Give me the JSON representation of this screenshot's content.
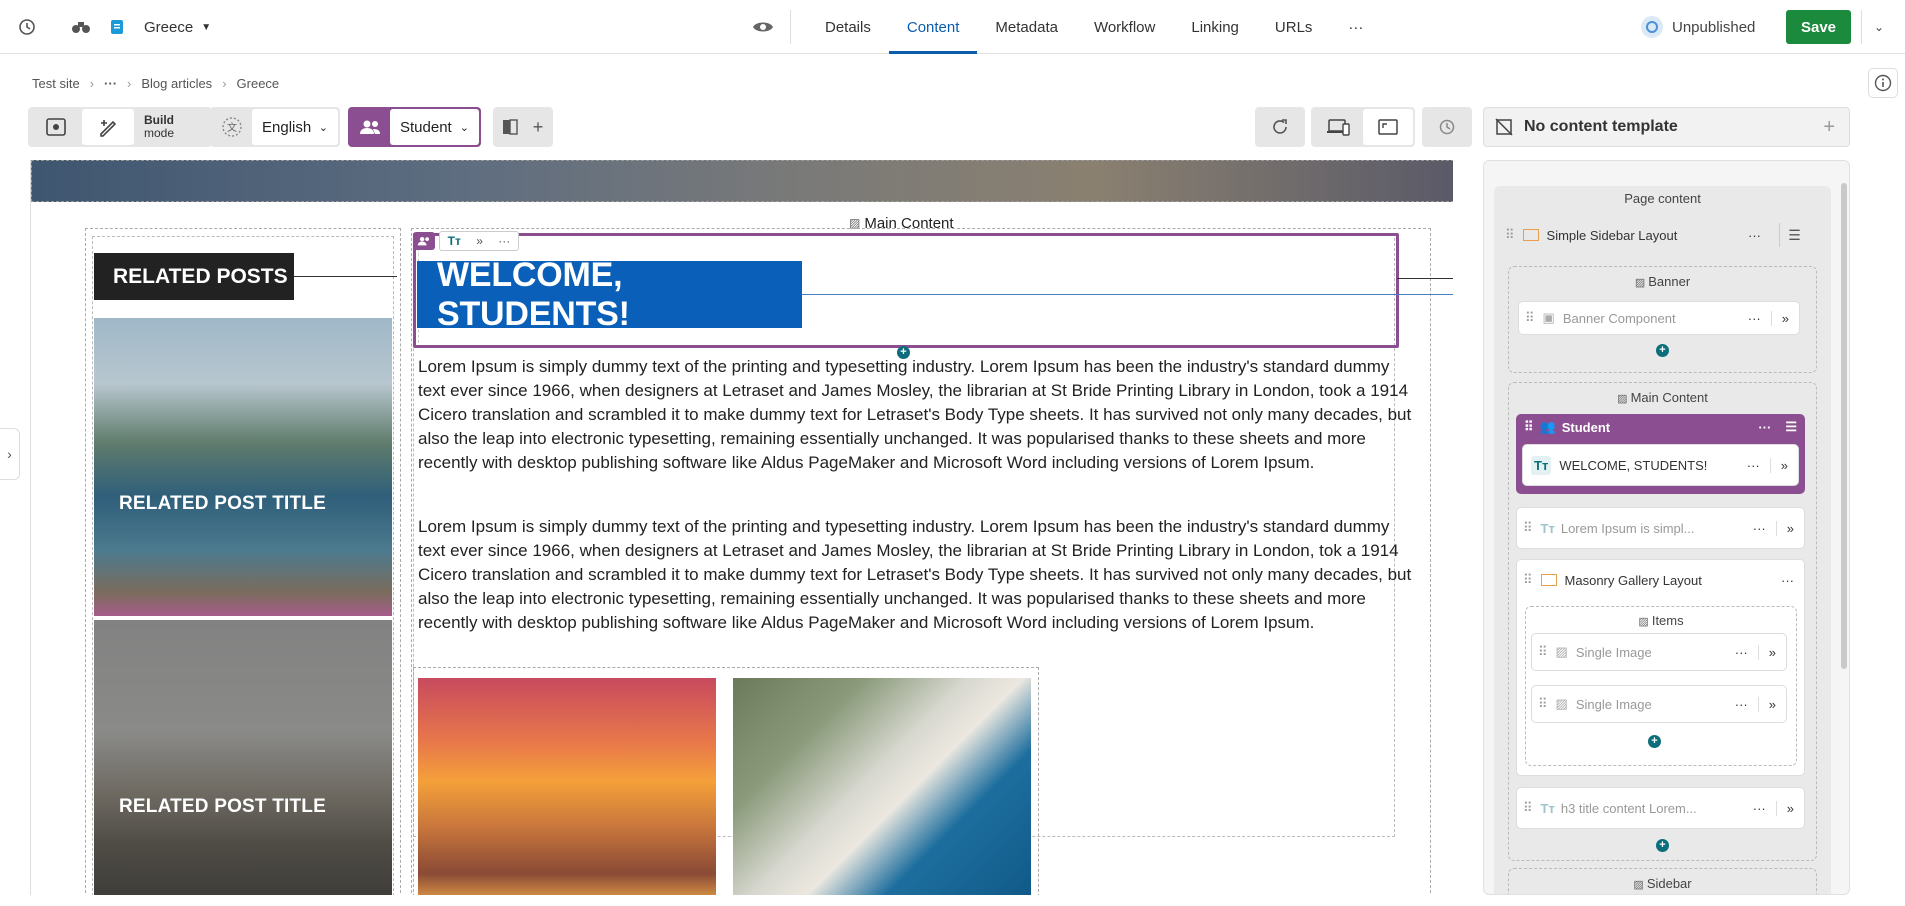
{
  "topbar": {
    "page_name": "Greece",
    "tabs": [
      "Details",
      "Content",
      "Metadata",
      "Workflow",
      "Linking",
      "URLs"
    ],
    "active_tab": "Content",
    "status": "Unpublished",
    "save_label": "Save"
  },
  "breadcrumb": {
    "items": [
      "Test site",
      "···",
      "Blog articles",
      "Greece"
    ]
  },
  "toolbar": {
    "build_mode_label_1": "Build",
    "build_mode_label_2": "mode",
    "language": "English",
    "audience": "Student",
    "template": "No content template"
  },
  "canvas": {
    "main_content_label": "Main Content",
    "related_posts_title": "RELATED POSTS",
    "related_post_title_1": "RELATED POST TITLE",
    "related_post_title_2": "RELATED POST TITLE",
    "welcome_heading": "WELCOME, STUDENTS!",
    "paragraph_1": "Lorem Ipsum is simply dummy text of the printing and typesetting industry. Lorem Ipsum has been the industry's standard dummy text ever since 1966, when designers at Letraset and James Mosley, the librarian at St Bride Printing Library in London, took a 1914 Cicero translation and scrambled it to make dummy text for Letraset's Body Type sheets. It has survived not only many decades, but also the leap into electronic typesetting, remaining essentially unchanged. It was popularised thanks to these sheets and more recently with desktop publishing software like Aldus PageMaker and Microsoft Word including versions of Lorem Ipsum.",
    "paragraph_2": " Lorem Ipsum is simply dummy text of the printing and typesetting industry. Lorem Ipsum has been the industry's standard dummy text ever since 1966, when designers at Letraset and James Mosley, the librarian at St Bride Printing Library in London, tok a 1914 Cicero translation and scrambled it to make dummy text for Letraset's Body Type sheets. It has survived not only many decades, but also the leap into electronic typesetting, remaining essentially unchanged. It was popularised thanks to these sheets and more recently with desktop publishing software like Aldus PageMaker and Microsoft Word including versions of Lorem Ipsum."
  },
  "panel": {
    "page_content": "Page content",
    "layout": "Simple Sidebar Layout",
    "banner_section": "Banner",
    "banner_component": "Banner Component",
    "main_content_section": "Main Content",
    "student_group": "Student",
    "welcome_item": "WELCOME, STUDENTS!",
    "lorem_item": "Lorem Ipsum is simpl...",
    "masonry": "Masonry Gallery Layout",
    "items_section": "Items",
    "single_image_1": "Single Image",
    "single_image_2": "Single Image",
    "h3_item": "h3 title content Lorem...",
    "sidebar_section": "Sidebar"
  }
}
